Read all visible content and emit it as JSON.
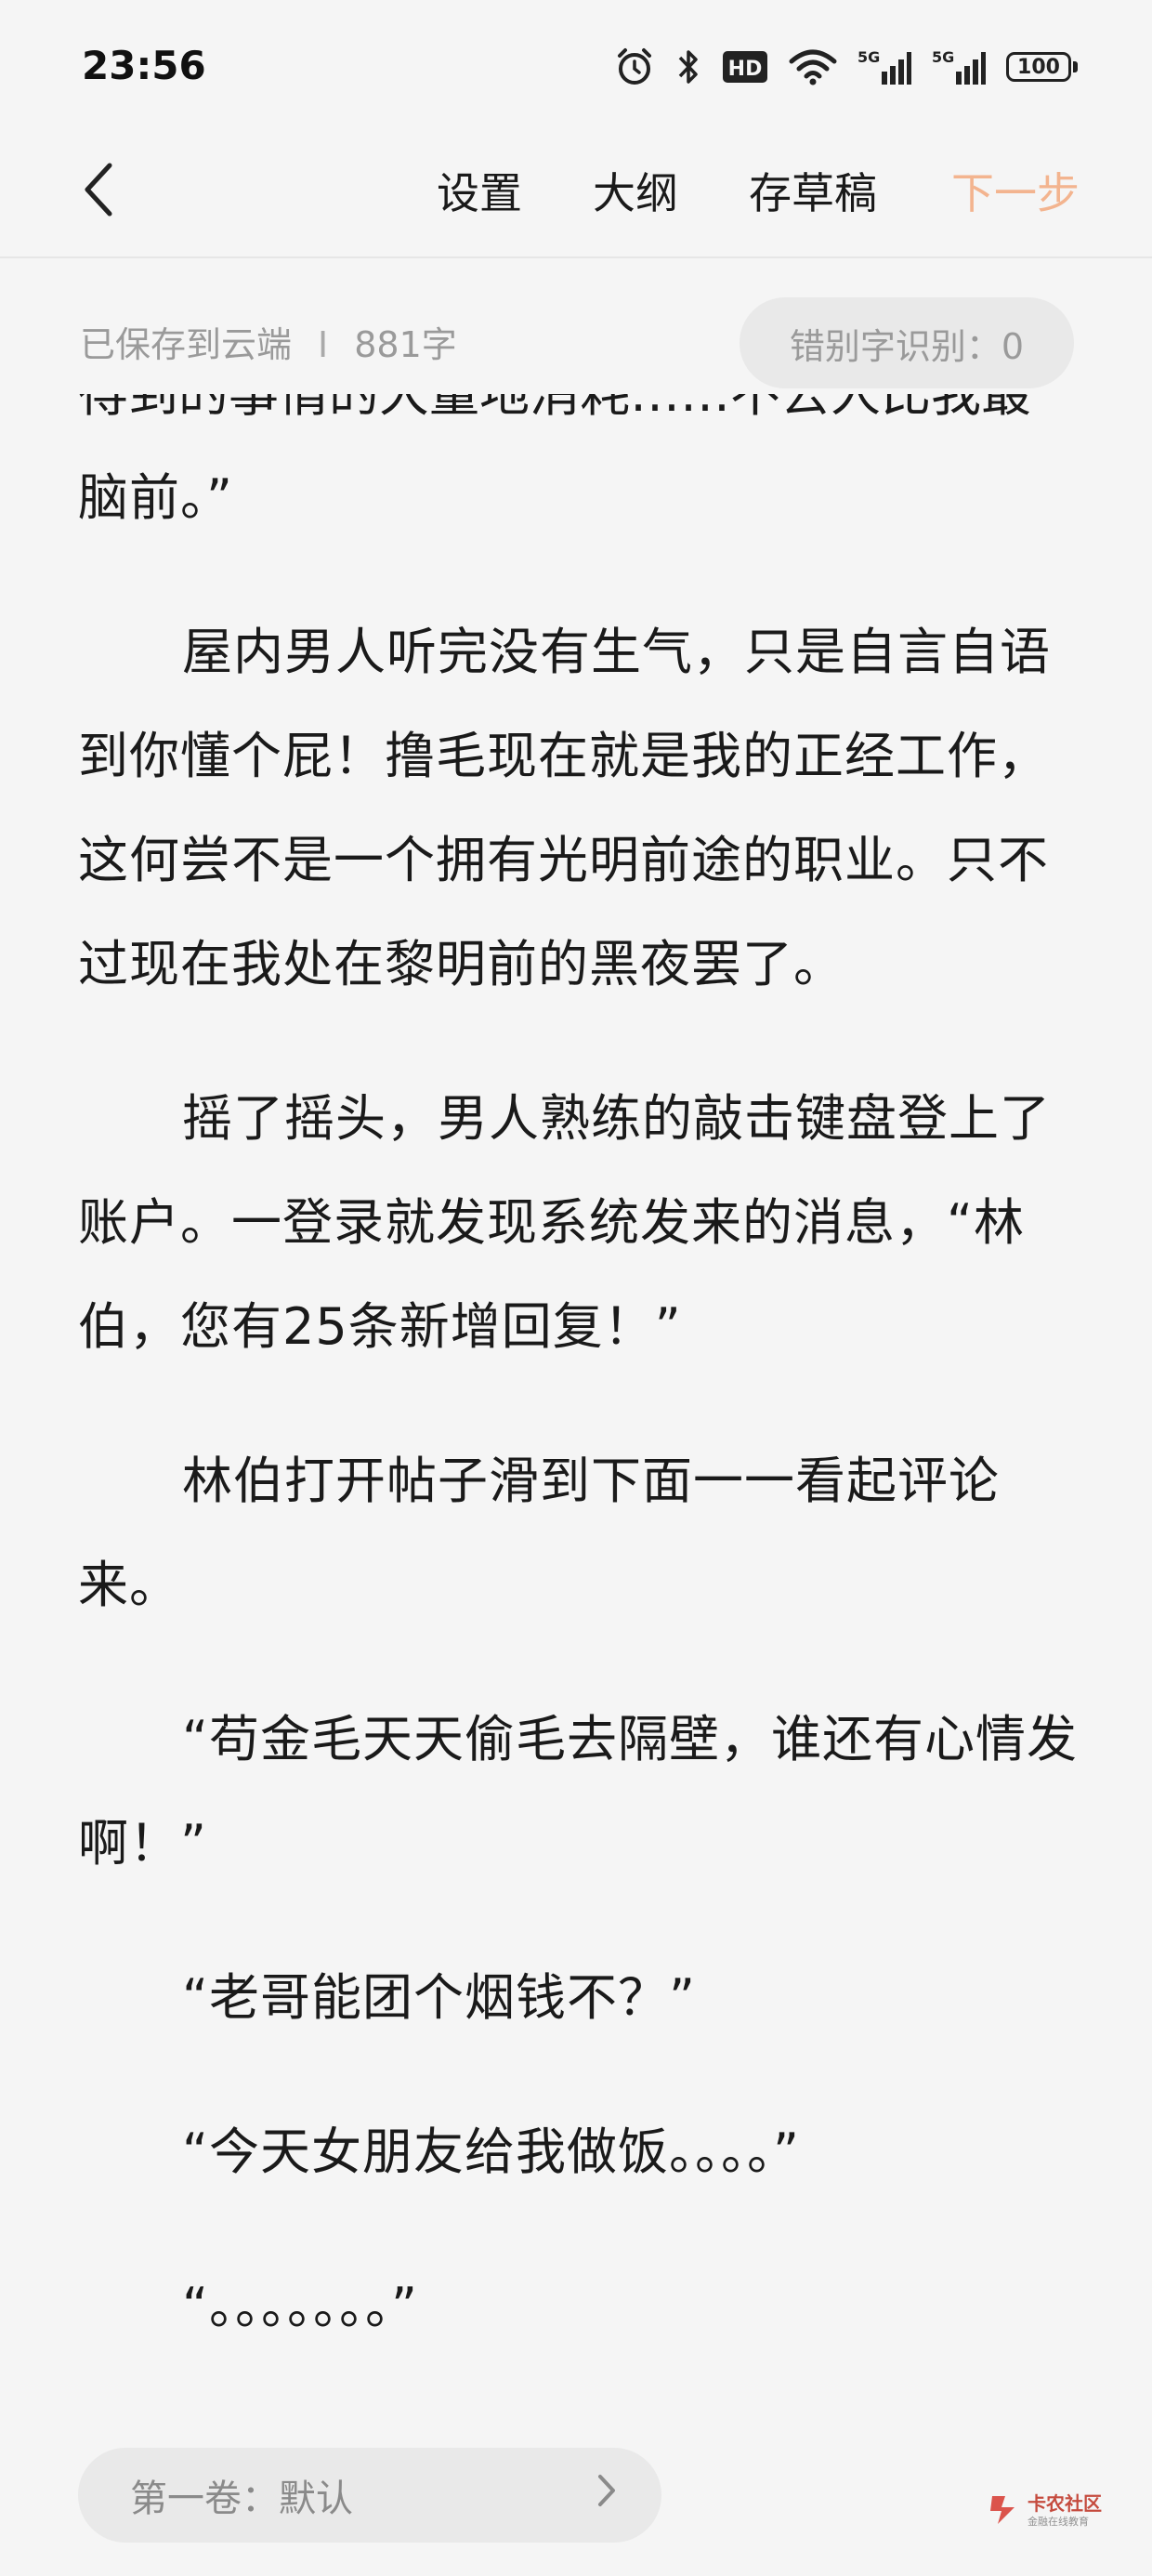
{
  "status_bar": {
    "time": "23:56",
    "icons": [
      "alarm-icon",
      "bluetooth-icon",
      "hd-icon",
      "wifi-icon",
      "signal-5g-icon",
      "signal-5g-icon"
    ],
    "hd_label": "HD",
    "signal_label": "5G",
    "battery": "100"
  },
  "nav": {
    "back_icon": "chevron-left-icon",
    "settings": "设置",
    "outline": "大纲",
    "draft": "存草稿",
    "next": "下一步",
    "next_color": "#f3b48f"
  },
  "info": {
    "save_status": "已保存到云端",
    "separator": "I",
    "word_count": "881字",
    "typo_check": "错别字识别：0"
  },
  "editor": {
    "partial_line": "得到的事情的大量地消耗……不去人比我最佳电",
    "paragraphs": [
      "脑前。”",
      "屋内男人听完没有生气，只是自言自语到你懂个屁！撸毛现在就是我的正经工作，这何尝不是一个拥有光明前途的职业。只不过现在我处在黎明前的黑夜罢了。",
      "摇了摇头，男人熟练的敲击键盘登上了账户。一登录就发现系统发来的消息，“林伯，您有25条新增回复！”",
      "林伯打开帖子滑到下面一一看起评论来。",
      "“苟金毛天天偷毛去隔壁，谁还有心情发啊！”",
      "“老哥能团个烟钱不？”",
      "“今天女朋友给我做饭。。。。”",
      "“。。。。。。。”"
    ]
  },
  "volume": {
    "label": "第一卷：默认",
    "arrow_icon": "chevron-right-icon"
  },
  "watermark": {
    "name": "卡农社区",
    "sub": "金融在线教育"
  }
}
